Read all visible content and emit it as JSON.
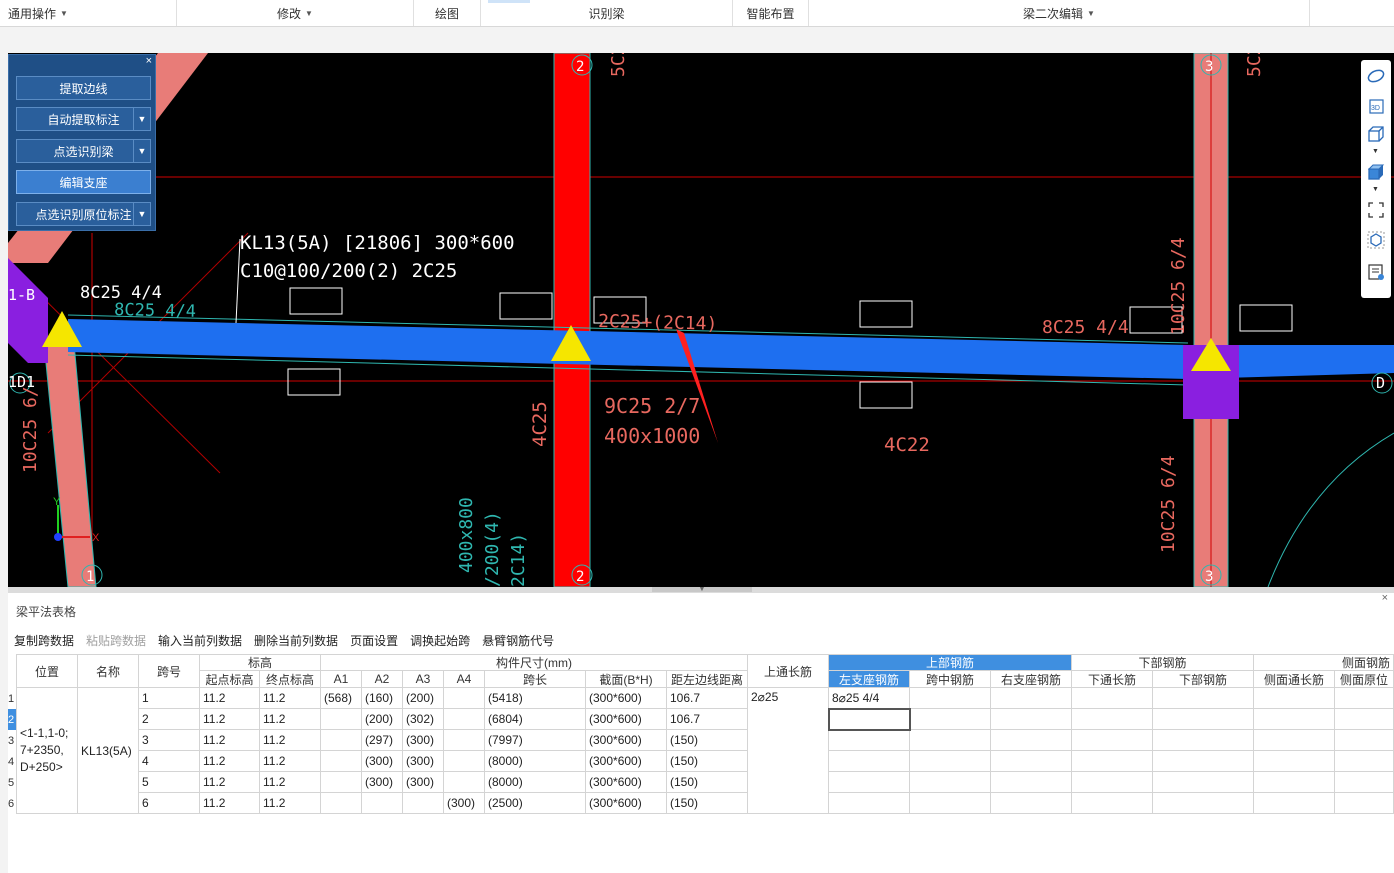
{
  "ribbon": {
    "groups": [
      {
        "label": "通用操作",
        "dropdown": true
      },
      {
        "label": "修改",
        "dropdown": true
      },
      {
        "label": "绘图",
        "dropdown": false
      },
      {
        "label": "识别梁",
        "dropdown": false
      },
      {
        "label": "智能布置",
        "dropdown": false
      },
      {
        "label": "梁二次编辑",
        "dropdown": true
      }
    ]
  },
  "panel": {
    "close": "×",
    "buttons": [
      {
        "label": "提取边线",
        "dropdown": false,
        "active": false
      },
      {
        "label": "自动提取标注",
        "dropdown": true,
        "active": false
      },
      {
        "label": "点选识别梁",
        "dropdown": true,
        "active": false
      },
      {
        "label": "编辑支座",
        "dropdown": false,
        "active": true
      },
      {
        "label": "点选识别原位标注",
        "dropdown": true,
        "active": false
      }
    ]
  },
  "cad": {
    "beam_label_line1": "KL13(5A) [21806] 300*600",
    "beam_label_line2": "C10@100/200(2) 2C25",
    "left_top_rebar": "8C25 4/4",
    "left_top_rebar_dim": "8C25 4/4",
    "axis_left_1b": "1-B",
    "axis_left_1d": "1D1",
    "axis_right_d": "D",
    "grid_2_top": "2",
    "grid_2_bottom": "2",
    "grid_3_top": "3",
    "grid_3_bottom": "3",
    "grid_1_bottom": "1",
    "col2_top_text": "5C2",
    "col3_top_text": "5C2",
    "mid_top_rebar": "2C25+(2C14)",
    "right_top_rebar": "8C25 4/4",
    "mid_bottom_rebar": "9C25 2/7",
    "mid_section": "400x1000",
    "bottom_4c25": "4C25",
    "bottom_4c22": "4C22",
    "col3_text_1": "10C25 6/4",
    "col3_text_2": "10C25 6/4",
    "left_col_text": "10C25 6/",
    "sect_text_a": "400x800",
    "sect_text_b": "/200(4)",
    "sect_text_c": "2C14)",
    "ucs_y": "Y",
    "ucs_x": "X"
  },
  "vtools": [
    "ellipse-icon",
    "3d-icon",
    "cube-icon",
    "cube-filled-icon",
    "fullscreen-icon",
    "component-icon",
    "properties-icon"
  ],
  "lower": {
    "title": "梁平法表格",
    "close": "×",
    "toolbar": [
      {
        "label": "复制跨数据",
        "disabled": false
      },
      {
        "label": "粘贴跨数据",
        "disabled": true
      },
      {
        "label": "输入当前列数据",
        "disabled": false
      },
      {
        "label": "删除当前列数据",
        "disabled": false
      },
      {
        "label": "页面设置",
        "disabled": false
      },
      {
        "label": "调换起始跨",
        "disabled": false
      },
      {
        "label": "悬臂钢筋代号",
        "disabled": false
      }
    ],
    "headers": {
      "position": "位置",
      "name": "名称",
      "span_no": "跨号",
      "elevation": "标高",
      "start_elev": "起点标高",
      "end_elev": "终点标高",
      "size": "构件尺寸(mm)",
      "a1": "A1",
      "a2": "A2",
      "a3": "A3",
      "a4": "A4",
      "span_len": "跨长",
      "section": "截面(B*H)",
      "left_dist": "距左边线距离",
      "top_through": "上通长筋",
      "top_rebar": "上部钢筋",
      "left_support": "左支座钢筋",
      "mid_span": "跨中钢筋",
      "right_support": "右支座钢筋",
      "bottom_rebar": "下部钢筋",
      "bottom_through": "下通长筋",
      "bottom_rebar_sub": "下部钢筋",
      "side_rebar": "侧面钢筋",
      "side_through": "侧面通长筋",
      "side_orig": "侧面原位"
    },
    "position_value": "<1-1,1-0;\n7+2350,\nD+250>",
    "name_value": "KL13(5A)",
    "top_through_value": "2⌀25",
    "rows": [
      {
        "num": "1",
        "span": "1",
        "start": "11.2",
        "end": "11.2",
        "a1": "(568)",
        "a2": "(160)",
        "a3": "(200)",
        "a4": "",
        "len": "(5418)",
        "sec": "(300*600)",
        "dist": "106.7",
        "left_support": "8⌀25 4/4"
      },
      {
        "num": "2",
        "span": "2",
        "start": "11.2",
        "end": "11.2",
        "a1": "",
        "a2": "(200)",
        "a3": "(302)",
        "a4": "",
        "len": "(6804)",
        "sec": "(300*600)",
        "dist": "106.7",
        "left_support": ""
      },
      {
        "num": "3",
        "span": "3",
        "start": "11.2",
        "end": "11.2",
        "a1": "",
        "a2": "(297)",
        "a3": "(300)",
        "a4": "",
        "len": "(7997)",
        "sec": "(300*600)",
        "dist": "(150)",
        "left_support": ""
      },
      {
        "num": "4",
        "span": "4",
        "start": "11.2",
        "end": "11.2",
        "a1": "",
        "a2": "(300)",
        "a3": "(300)",
        "a4": "",
        "len": "(8000)",
        "sec": "(300*600)",
        "dist": "(150)",
        "left_support": ""
      },
      {
        "num": "5",
        "span": "5",
        "start": "11.2",
        "end": "11.2",
        "a1": "",
        "a2": "(300)",
        "a3": "(300)",
        "a4": "",
        "len": "(8000)",
        "sec": "(300*600)",
        "dist": "(150)",
        "left_support": ""
      },
      {
        "num": "6",
        "span": "6",
        "start": "11.2",
        "end": "11.2",
        "a1": "",
        "a2": "",
        "a3": "",
        "a4": "(300)",
        "len": "(2500)",
        "sec": "(300*600)",
        "dist": "(150)",
        "left_support": ""
      }
    ]
  },
  "colors": {
    "beam_blue": "#1e6ff0",
    "column_red": "#ff0000",
    "column_salmon": "#e87c78",
    "purple": "#8a1fe0",
    "support_yellow": "#f5e600",
    "cad_annot": "#e8685f",
    "cad_cyan": "#2fb7b0",
    "header_blue": "#3f8fe0"
  }
}
